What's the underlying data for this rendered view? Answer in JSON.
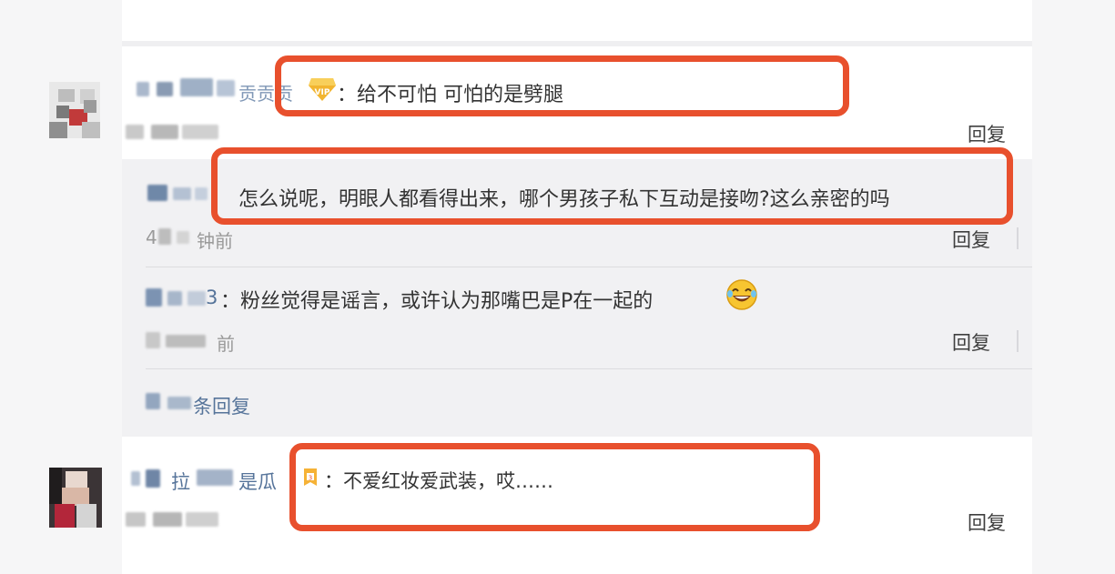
{
  "comments": [
    {
      "text": "：给不可怕 可怕的是劈腿",
      "name_suffix": "贡贡贡",
      "reply_label": "回复"
    },
    {
      "text": "：不爱红妆爱武装，哎……",
      "name_visible_1": "拉",
      "name_visible_2": "是瓜",
      "reply_label": "回复"
    }
  ],
  "replies": [
    {
      "text": "怎么说呢，明眼人都看得出来，哪个男孩子私下互动是接吻?这么亲密的吗",
      "time": "钟前",
      "time_prefix": "4",
      "reply_label": "回复"
    },
    {
      "name_suffix": "3",
      "text": "：粉丝觉得是谣言，或许认为那嘴巴是P在一起的",
      "time_suffix": "前",
      "reply_label": "回复"
    }
  ],
  "more_replies_label": "条回复",
  "colors": {
    "highlight": "#e8502d",
    "username": "#56749a",
    "panel": "#f1f1f3"
  },
  "icons": [
    "vip-diamond-icon",
    "laughing-emoji-icon",
    "level-badge-icon"
  ]
}
